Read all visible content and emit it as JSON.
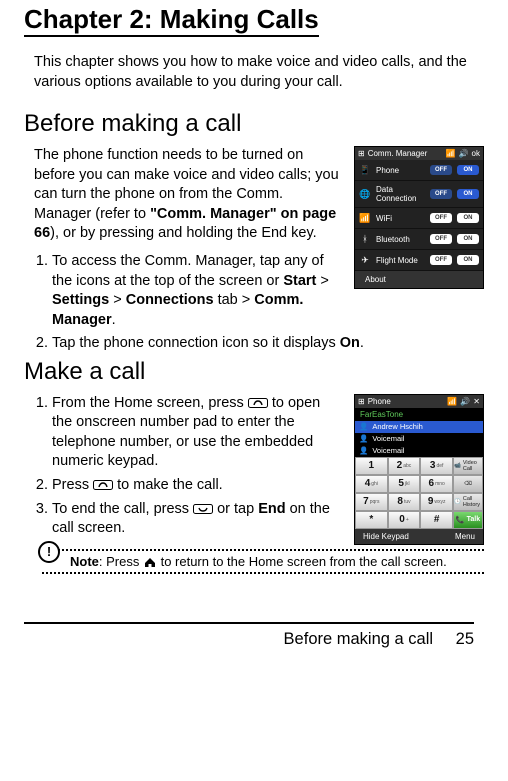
{
  "chapter_title": "Chapter 2: Making Calls",
  "intro": "This chapter shows you how to make voice and video calls, and the various options available to you during your call.",
  "section1": {
    "heading": "Before making a call",
    "p1_a": "The phone function needs to be turned on before you can make voice and video calls; you can turn the phone on from the Comm. Manager (refer to ",
    "p1_b": "\"Comm. Manager\" on page 66",
    "p1_c": "), or by pressing and holding the End key.",
    "list": {
      "i1_a": "To access the Comm. Manager, tap any of the icons at the top of the screen or ",
      "i1_start": "Start",
      "i1_gt1": " > ",
      "i1_settings": "Settings",
      "i1_gt2": " > ",
      "i1_conn": "Connections",
      "i1_tab": " tab > ",
      "i1_cm": "Comm. Manager",
      "i1_dot": ".",
      "i2_a": "Tap the phone connection icon so it displays ",
      "i2_on": "On",
      "i2_dot": "."
    }
  },
  "section2": {
    "heading": "Make a call",
    "list": {
      "i1_a": "From the Home screen, press ",
      "i1_b": " to open the onscreen number pad to enter the telephone number, or use the embedded numeric keypad.",
      "i2_a": "Press ",
      "i2_b": " to make the call.",
      "i3_a": "To end the call, press ",
      "i3_b": " or tap ",
      "i3_end": "End",
      "i3_c": " on the call screen."
    }
  },
  "note": {
    "label": "Note",
    "a": ": Press ",
    "b": " to return to the Home screen from the call screen."
  },
  "footer": {
    "section": "Before making a call",
    "page": "25"
  },
  "fig1": {
    "title": "Comm. Manager",
    "ok": "ok",
    "rows": [
      {
        "label": "Phone",
        "off_active": false,
        "on_active": true
      },
      {
        "label": "Data Connection",
        "off_active": false,
        "on_active": true
      },
      {
        "label": "WiFi",
        "off_active": true,
        "on_active": false
      },
      {
        "label": "Bluetooth",
        "off_active": true,
        "on_active": false
      },
      {
        "label": "Flight Mode",
        "off_active": true,
        "on_active": false
      }
    ],
    "off": "OFF",
    "on": "ON",
    "about": "About"
  },
  "fig2": {
    "title": "Phone",
    "close": "✕",
    "carrier": "FarEasTone",
    "contacts": [
      {
        "name": "Andrew Hschih",
        "sel": true
      },
      {
        "name": "Voicemail",
        "sel": false
      },
      {
        "name": "Voicemail",
        "sel": false
      }
    ],
    "keys": [
      {
        "d": "1",
        "l": ""
      },
      {
        "d": "2",
        "l": "abc"
      },
      {
        "d": "3",
        "l": "def"
      },
      {
        "d": "4",
        "l": "ghi"
      },
      {
        "d": "5",
        "l": "jkl"
      },
      {
        "d": "6",
        "l": "mno"
      },
      {
        "d": "7",
        "l": "pqrs"
      },
      {
        "d": "8",
        "l": "tuv"
      },
      {
        "d": "9",
        "l": "wxyz"
      },
      {
        "d": "*",
        "l": ""
      },
      {
        "d": "0",
        "l": "+"
      },
      {
        "d": "#",
        "l": ""
      }
    ],
    "side": {
      "vcall": "Video Call",
      "del": "⌫",
      "hist": "Call History",
      "talk": "Talk"
    },
    "hide": "Hide Keypad",
    "menu": "Menu"
  }
}
